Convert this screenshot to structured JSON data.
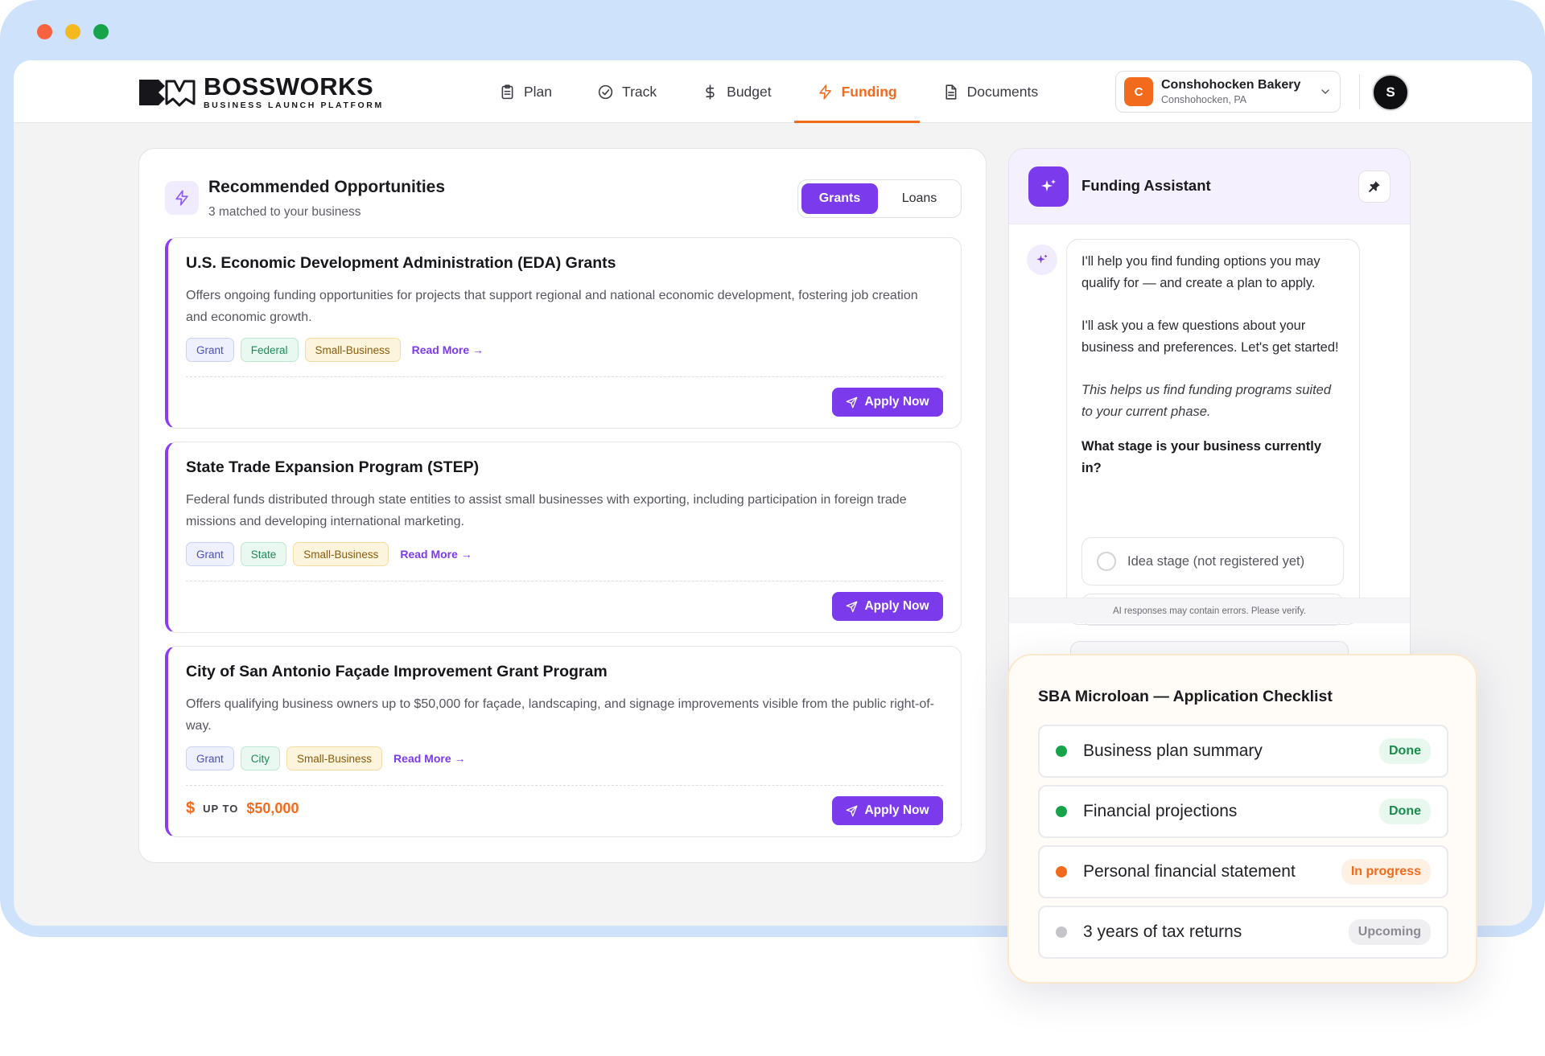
{
  "window": {
    "dots": [
      "#f8623e",
      "#f5b920",
      "#16a34a"
    ]
  },
  "brand": {
    "name": "BOSSWORKS",
    "tagline": "BUSINESS LAUNCH PLATFORM"
  },
  "nav": {
    "items": [
      {
        "label": "Plan",
        "icon": "clipboard-icon"
      },
      {
        "label": "Track",
        "icon": "check-circle-icon"
      },
      {
        "label": "Budget",
        "icon": "dollar-icon"
      },
      {
        "label": "Funding",
        "icon": "lightning-icon",
        "active": true
      },
      {
        "label": "Documents",
        "icon": "document-icon"
      }
    ]
  },
  "business": {
    "initial": "C",
    "name": "Conshohocken Bakery",
    "location": "Conshohocken, PA"
  },
  "user": {
    "initial": "S"
  },
  "opportunities": {
    "title": "Recommended Opportunities",
    "subtitle": "3 matched to your business",
    "toggle": [
      "Grants",
      "Loans"
    ],
    "read_more": "Read More",
    "apply_label": "Apply Now",
    "items": [
      {
        "title": "U.S. Economic Development Administration (EDA) Grants",
        "description": "Offers ongoing funding opportunities for projects that support regional and national economic development, fostering job creation and economic growth.",
        "tags": [
          "Grant",
          "Federal",
          "Small-Business"
        ]
      },
      {
        "title": "State Trade Expansion Program (STEP)",
        "description": "Federal funds distributed through state entities to assist small businesses with exporting, including participation in foreign trade missions and developing international marketing.",
        "tags": [
          "Grant",
          "State",
          "Small-Business"
        ]
      },
      {
        "title": "City of San Antonio Façade Improvement Grant Program",
        "description": "Offers qualifying business owners up to $50,000 for façade, landscaping, and signage improvements visible from the public right-of-way.",
        "tags": [
          "Grant",
          "City",
          "Small-Business"
        ],
        "amount_prefix": "UP TO",
        "amount": "$50,000",
        "amount_symbol": "$"
      }
    ]
  },
  "assistant": {
    "title": "Funding Assistant",
    "messages": {
      "p1": "I'll help you find funding options you may qualify for — and create a plan to apply.",
      "p2": "I'll ask you a few questions about your business and preferences. Let's get started!",
      "p3": "This helps us find funding programs suited to your current phase.",
      "question": "What stage is your business currently in?"
    },
    "options": [
      "Idea stage (not registered yet)"
    ],
    "disclaimer": "AI responses may contain errors. Please verify."
  },
  "checklist": {
    "title": "SBA Microloan — Application Checklist",
    "items": [
      {
        "label": "Business plan summary",
        "status": "Done",
        "color": "#16a34a"
      },
      {
        "label": "Financial projections",
        "status": "Done",
        "color": "#16a34a"
      },
      {
        "label": "Personal financial statement",
        "status": "In progress",
        "color": "#f26a1b"
      },
      {
        "label": "3 years of tax returns",
        "status": "Upcoming",
        "color": "#c4c4ca"
      }
    ]
  }
}
